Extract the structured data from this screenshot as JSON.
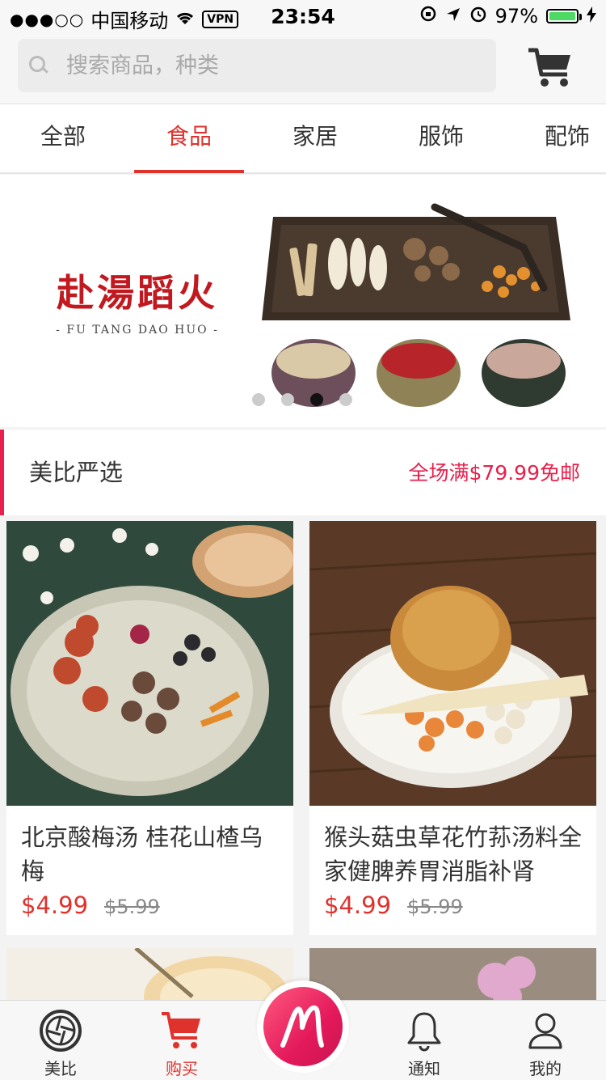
{
  "status_bar": {
    "signal": "●●●○○",
    "carrier": "中国移动",
    "vpn": "VPN",
    "time": "23:54",
    "battery": "97%"
  },
  "search": {
    "placeholder": "搜索商品，种类"
  },
  "category_tabs": [
    {
      "label": "全部",
      "active": false
    },
    {
      "label": "食品",
      "active": true
    },
    {
      "label": "家居",
      "active": false
    },
    {
      "label": "服饰",
      "active": false
    },
    {
      "label": "配饰",
      "active": false
    }
  ],
  "banner": {
    "brand_cn": "赴湯蹈火",
    "brand_en": "- FU TANG DAO HUO -",
    "active_dot_index": 2,
    "dot_count": 4
  },
  "section": {
    "title": "美比严选",
    "promo": "全场满$79.99免邮"
  },
  "products": [
    {
      "name": "北京酸梅汤 桂花山楂乌梅",
      "price": "$4.99",
      "original_price": "$5.99"
    },
    {
      "name": "猴头菇虫草花竹荪汤料全家健脾养胃消脂补肾",
      "price": "$4.99",
      "original_price": "$5.99"
    }
  ],
  "tabbar": [
    {
      "label": "美比",
      "icon": "aperture-icon",
      "active": false
    },
    {
      "label": "购买",
      "icon": "cart-icon",
      "active": true
    },
    {
      "label": "",
      "icon": "m-logo-icon",
      "active": false
    },
    {
      "label": "通知",
      "icon": "bell-icon",
      "active": false
    },
    {
      "label": "我的",
      "icon": "user-icon",
      "active": false
    }
  ],
  "colors": {
    "accent_red": "#e0322d",
    "promo_pink": "#e8204b"
  }
}
